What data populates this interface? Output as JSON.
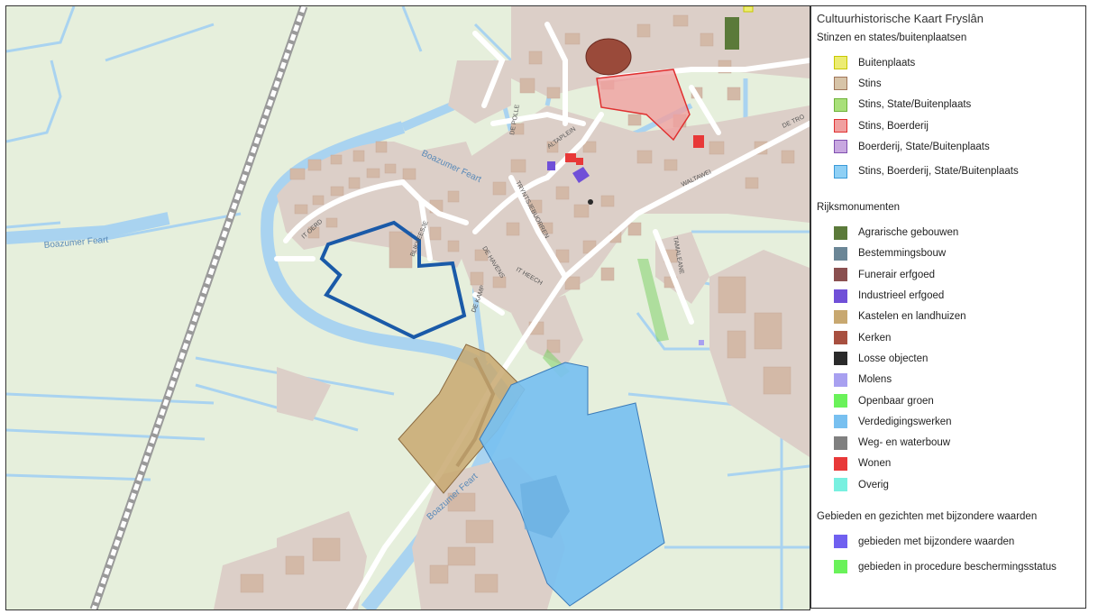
{
  "map": {
    "labels": {
      "canal_west": "Boazumer Feart",
      "canal_north": "Boazumer Feart",
      "canal_south": "Boazumer Feart",
      "street_1": "IT OERD",
      "street_2": "BLIKKEESJE",
      "street_3": "DE HAVENS",
      "street_4": "DE KAMP",
      "street_5": "IT HEECH",
      "street_6": "TRYNTSJEBUORREN",
      "street_7": "ALTAPLEIN",
      "street_8": "DE POLLE",
      "street_9": "WALTAWEI",
      "street_10": "TAMALEANE",
      "street_11": "DE TRO"
    }
  },
  "legend": {
    "title": "Cultuurhistorische Kaart Fryslân",
    "sections": [
      {
        "heading": "Stinzen en states/buitenplaatsen",
        "items": [
          {
            "label": "Buitenplaats",
            "fill": "#ecec72",
            "stroke": "#c8c800"
          },
          {
            "label": "Stins",
            "fill": "#d7c4a8",
            "stroke": "#a0765a"
          },
          {
            "label": "Stins, State/Buitenplaats",
            "fill": "#a9e07a",
            "stroke": "#6fb23a"
          },
          {
            "label": "Stins, Boerderij",
            "fill": "#f0a0a0",
            "stroke": "#e03030"
          },
          {
            "label": "Boerderij, State/Buitenplaats",
            "fill": "#c8a8e0",
            "stroke": "#8050b0"
          },
          {
            "label": "Stins, Boerderij, State/Buitenplaats",
            "fill": "#8fd0f5",
            "stroke": "#3a9ad8"
          }
        ]
      },
      {
        "heading": "Rijksmonumenten",
        "items": [
          {
            "label": "Agrarische gebouwen",
            "fill": "#5b7a3a",
            "stroke": "#5b7a3a"
          },
          {
            "label": "Bestemmingsbouw",
            "fill": "#6b8696",
            "stroke": "#6b8696"
          },
          {
            "label": "Funerair erfgoed",
            "fill": "#8a5050",
            "stroke": "#8a5050"
          },
          {
            "label": "Industrieel erfgoed",
            "fill": "#7050d8",
            "stroke": "#7050d8"
          },
          {
            "label": "Kastelen en landhuizen",
            "fill": "#c8a870",
            "stroke": "#c8a870"
          },
          {
            "label": "Kerken",
            "fill": "#a85040",
            "stroke": "#a85040"
          },
          {
            "label": "Losse objecten",
            "fill": "#2a2a2a",
            "stroke": "#2a2a2a"
          },
          {
            "label": "Molens",
            "fill": "#a8a0f0",
            "stroke": "#a8a0f0"
          },
          {
            "label": "Openbaar groen",
            "fill": "#6af25a",
            "stroke": "#6af25a"
          },
          {
            "label": "Verdedigingswerken",
            "fill": "#78c0f0",
            "stroke": "#78c0f0"
          },
          {
            "label": "Weg- en waterbouw",
            "fill": "#808080",
            "stroke": "#808080"
          },
          {
            "label": "Wonen",
            "fill": "#e83838",
            "stroke": "#e83838"
          },
          {
            "label": "Overig",
            "fill": "#78f0e0",
            "stroke": "#78f0e0"
          }
        ]
      },
      {
        "heading": "Gebieden en gezichten met bijzondere waarden",
        "items": [
          {
            "label": "gebieden met bijzondere waarden",
            "fill": "#7060f0",
            "stroke": "#7060f0"
          },
          {
            "label": "gebieden in procedure beschermingsstatus",
            "fill": "#6af25a",
            "stroke": "#6af25a"
          }
        ]
      }
    ]
  }
}
